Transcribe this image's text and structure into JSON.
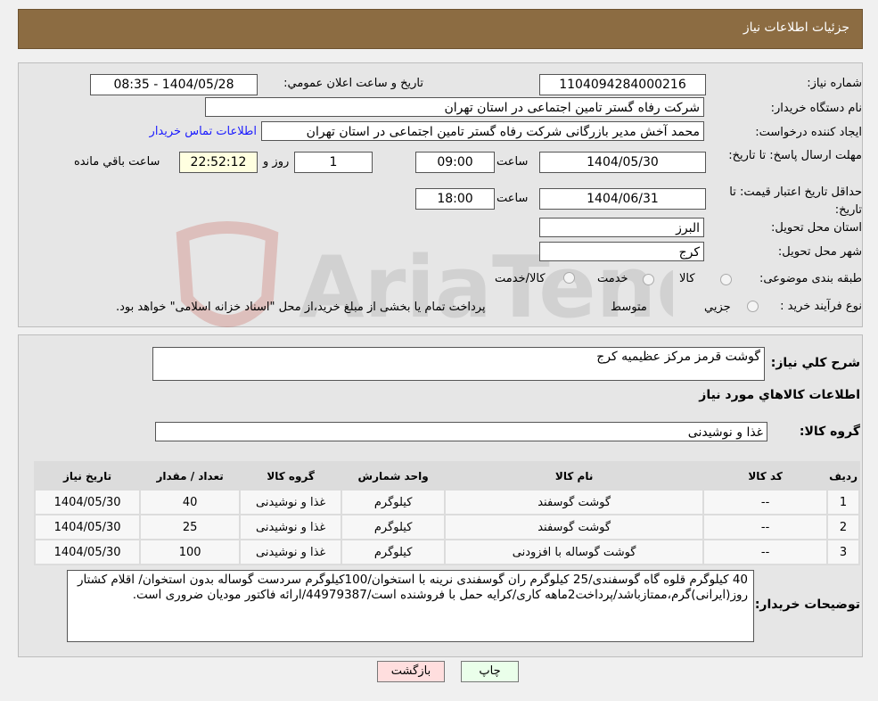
{
  "header": {
    "title": "جزئيات اطلاعات نياز"
  },
  "form": {
    "need_number_label": "شماره نیاز:",
    "need_number": "1104094284000216",
    "announce_label": "تاريخ و ساعت اعلان عمومي:",
    "announce_value": "1404/05/28 - 08:35",
    "buyer_label": "نام دستگاه خريدار:",
    "buyer": "شرکت رفاه گستر تامین اجتماعی در استان تهران",
    "creator_label": "ايجاد کننده درخواست:",
    "creator": "محمد آخش مدیر بازرگانی شرکت رفاه گستر تامین اجتماعی در استان تهران",
    "contact_link": "اطلاعات تماس خريدار",
    "deadline_label": "مهلت ارسال پاسخ: تا تاريخ:",
    "deadline_date": "1404/05/30",
    "time_label": "ساعت",
    "deadline_time": "09:00",
    "days": "1",
    "days_label": "روز و",
    "remaining": "22:52:12",
    "remaining_label": "ساعت باقي مانده",
    "validity_label": "حداقل تاريخ اعتبار قيمت: تا تاريخ:",
    "validity_date": "1404/06/31",
    "validity_time": "18:00",
    "province_label": "استان محل تحويل:",
    "province": "البرز",
    "city_label": "شهر محل تحويل:",
    "city": "کرج",
    "category_label": "طبقه بندی موضوعی:",
    "category_options": [
      "کالا",
      "خدمت",
      "کالا/خدمت"
    ],
    "process_label": "نوع فرآیند خرید :",
    "process_options": [
      "جزيي",
      "متوسط"
    ],
    "process_note": "پرداخت تمام يا بخشی از مبلغ خريد،از محل \"اسناد خزانه اسلامی\" خواهد بود."
  },
  "details": {
    "summary_label": "شرح کلي نياز:",
    "summary": "گوشت قرمز مرکز عظیمیه کرج",
    "goods_title": "اطلاعات کالاهاي مورد نياز",
    "group_label": "گروه کالا:",
    "group": "غذا و نوشیدنی",
    "table": {
      "headers": [
        "رديف",
        "کد کالا",
        "نام کالا",
        "واحد شمارش",
        "گروه کالا",
        "تعداد / مقدار",
        "تاريخ نياز"
      ],
      "rows": [
        [
          "1",
          "--",
          "گوشت گوسفند",
          "کيلوگرم",
          "غذا و نوشيدنی",
          "40",
          "1404/05/30"
        ],
        [
          "2",
          "--",
          "گوشت گوسفند",
          "کيلوگرم",
          "غذا و نوشيدنی",
          "25",
          "1404/05/30"
        ],
        [
          "3",
          "--",
          "گوشت گوساله با افزودنی",
          "کيلوگرم",
          "غذا و نوشيدنی",
          "100",
          "1404/05/30"
        ]
      ]
    },
    "notes_label": "توضيحات خريدار:",
    "notes": "40 کیلوگرم قلوه گاه گوسفندی/25 کیلوگرم ران گوسفندی نرینه با استخوان/100کیلوگرم سردست گوساله بدون استخوان/ اقلام کشتار روز(ایرانی)گرم،ممتازباشد/پرداخت2ماهه کاری/کرایه حمل با فروشنده است/44979387/ارائه فاکتور مودیان ضروری است."
  },
  "buttons": {
    "print": "چاپ",
    "back": "بازگشت"
  },
  "watermark": "AriaTender.neT"
}
